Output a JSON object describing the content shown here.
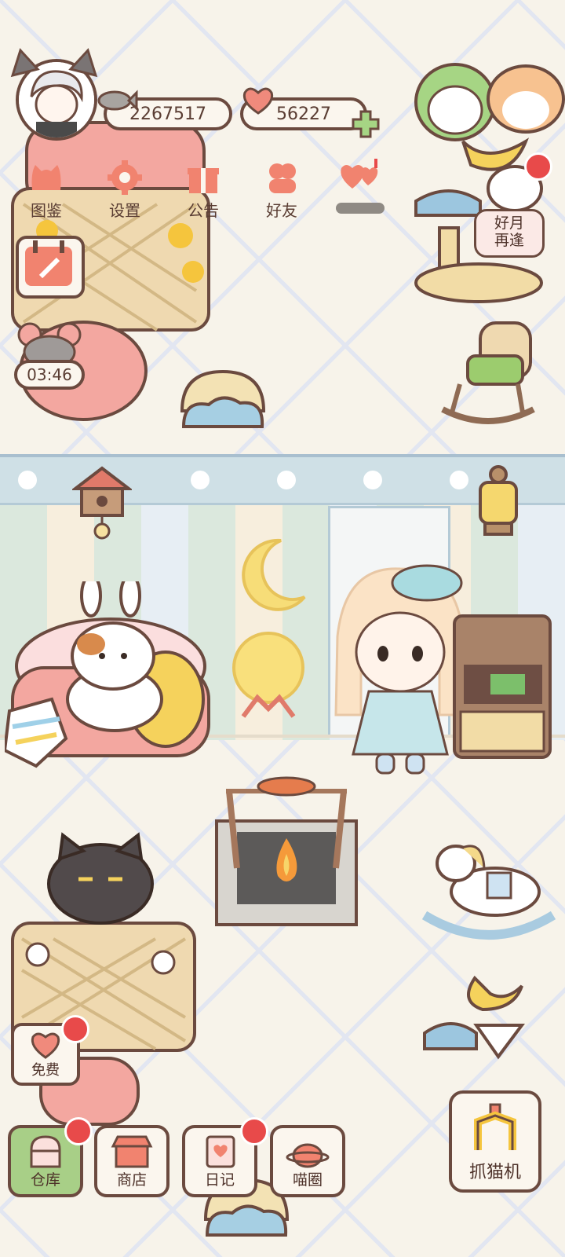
{
  "resources": {
    "fish_count": "2267517",
    "heart_count": "56227"
  },
  "top_menu": [
    {
      "label": "图鉴",
      "icon": "cat-face-icon"
    },
    {
      "label": "设置",
      "icon": "gear-icon"
    },
    {
      "label": "公告",
      "icon": "gift-icon"
    },
    {
      "label": "好友",
      "icon": "friends-icon"
    },
    {
      "label": "",
      "icon": "hearts-icon"
    }
  ],
  "event_tag": {
    "line1": "好月",
    "line2": "再逢"
  },
  "timer": "03:46",
  "free_button": "免费",
  "bottom_nav": [
    {
      "label": "仓库",
      "active": true,
      "badge": true
    },
    {
      "label": "商店",
      "active": false,
      "badge": false
    },
    {
      "label": "日记",
      "active": false,
      "badge": true
    },
    {
      "label": "喵圈",
      "active": false,
      "badge": false
    }
  ],
  "claw_machine": "抓猫机",
  "colors": {
    "outline": "#6b4a3f",
    "active_green": "#a8cf87",
    "badge_red": "#e84a4a",
    "pink": "#f3a7a0"
  }
}
